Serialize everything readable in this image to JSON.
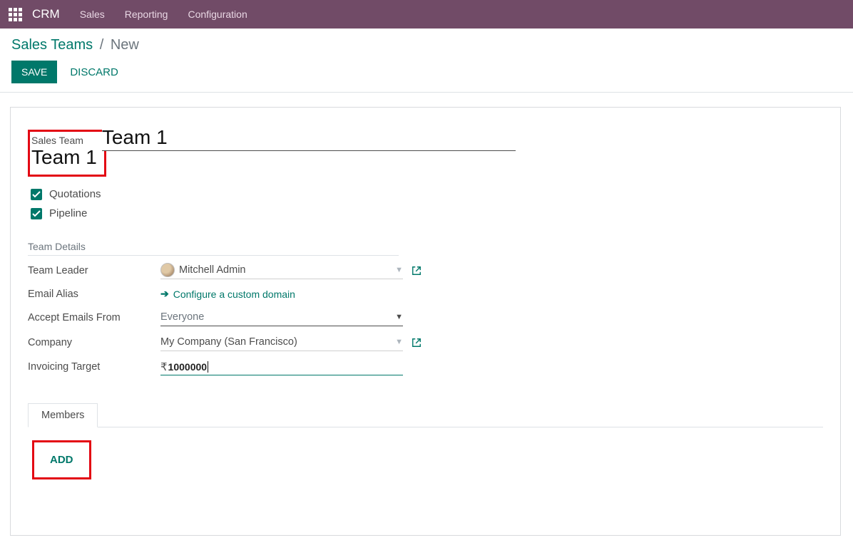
{
  "navbar": {
    "brand": "CRM",
    "links": [
      "Sales",
      "Reporting",
      "Configuration"
    ]
  },
  "breadcrumb": {
    "root": "Sales Teams",
    "current": "New"
  },
  "actions": {
    "save": "SAVE",
    "discard": "DISCARD"
  },
  "form": {
    "title_label": "Sales Team",
    "title_value": "Team 1",
    "check_quotations_label": "Quotations",
    "check_quotations_checked": true,
    "check_pipeline_label": "Pipeline",
    "check_pipeline_checked": true,
    "section_title": "Team Details",
    "fields": {
      "team_leader_label": "Team Leader",
      "team_leader_value": "Mitchell Admin",
      "email_alias_label": "Email Alias",
      "email_alias_link": "Configure a custom domain",
      "accept_emails_label": "Accept Emails From",
      "accept_emails_value": "Everyone",
      "company_label": "Company",
      "company_value": "My Company (San Francisco)",
      "invoicing_label": "Invoicing Target",
      "invoicing_currency": "₹",
      "invoicing_value": "1000000"
    },
    "tabs": {
      "members": "Members",
      "add": "ADD"
    }
  }
}
